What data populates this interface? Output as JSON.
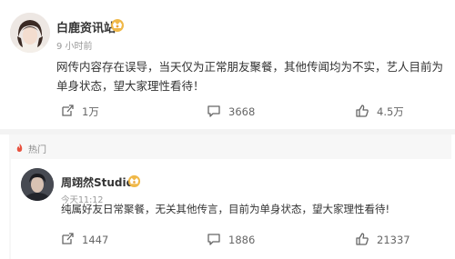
{
  "main_post": {
    "author": "白鹿资讯站",
    "timestamp": "9 小时前",
    "content": "网传内容存在误导，当天仅为正常朋友聚餐，其他传闻均为不实，艺人目前为单身状态，望大家理性看待！",
    "actions": {
      "repost": "1万",
      "comment": "3668",
      "like": "4.5万"
    }
  },
  "hot_section": {
    "label": "热门"
  },
  "reply_post": {
    "author": "周翊然Studio",
    "timestamp": "今天11:12",
    "content": "纯属好友日常聚餐，无关其他传言，目前为单身状态，望大家理性看待!",
    "actions": {
      "repost": "1447",
      "comment": "1886",
      "like": "21337"
    }
  },
  "colors": {
    "badge_gold": "#e8a23a",
    "hot_red": "#e8523f",
    "muted_text": "#999999"
  },
  "icons": [
    "avatar-photo",
    "crown-badge",
    "repost-icon",
    "comment-icon",
    "like-icon",
    "flame-icon"
  ]
}
